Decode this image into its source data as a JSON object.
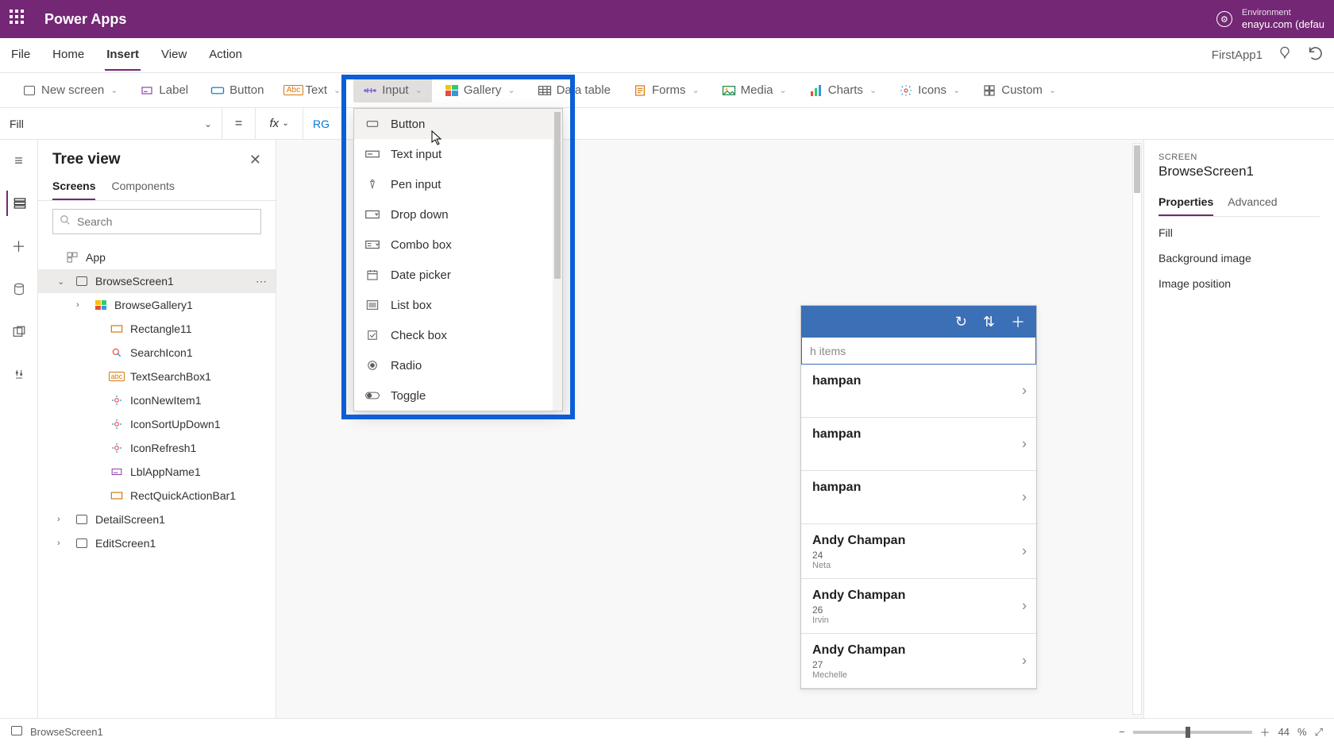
{
  "topbar": {
    "title": "Power Apps",
    "env_label": "Environment",
    "env_value": "enayu.com (defau"
  },
  "menubar": {
    "items": [
      "File",
      "Home",
      "Insert",
      "View",
      "Action"
    ],
    "active_index": 2,
    "app_name": "FirstApp1"
  },
  "ribbon": {
    "items": [
      {
        "label": "New screen",
        "chev": true
      },
      {
        "label": "Label"
      },
      {
        "label": "Button"
      },
      {
        "label": "Text",
        "chev": true
      },
      {
        "label": "Input",
        "chev": true,
        "expanded": true
      },
      {
        "label": "Gallery",
        "chev": true
      },
      {
        "label": "Data table"
      },
      {
        "label": "Forms",
        "chev": true
      },
      {
        "label": "Media",
        "chev": true
      },
      {
        "label": "Charts",
        "chev": true
      },
      {
        "label": "Icons",
        "chev": true
      },
      {
        "label": "Custom",
        "chev": true
      }
    ]
  },
  "formula": {
    "property": "Fill",
    "value": "RG"
  },
  "tree": {
    "title": "Tree view",
    "tabs": [
      "Screens",
      "Components"
    ],
    "active_tab": 0,
    "search_placeholder": "Search",
    "nodes": [
      {
        "label": "App",
        "level": 0,
        "icon": "app"
      },
      {
        "label": "BrowseScreen1",
        "level": 1,
        "icon": "screen",
        "expanded": true,
        "selected": true,
        "more": true
      },
      {
        "label": "BrowseGallery1",
        "level": 2,
        "icon": "gallery",
        "expandable": true
      },
      {
        "label": "Rectangle11",
        "level": 3,
        "icon": "rect"
      },
      {
        "label": "SearchIcon1",
        "level": 3,
        "icon": "search"
      },
      {
        "label": "TextSearchBox1",
        "level": 3,
        "icon": "textbox"
      },
      {
        "label": "IconNewItem1",
        "level": 3,
        "icon": "iconctrl"
      },
      {
        "label": "IconSortUpDown1",
        "level": 3,
        "icon": "iconctrl"
      },
      {
        "label": "IconRefresh1",
        "level": 3,
        "icon": "iconctrl"
      },
      {
        "label": "LblAppName1",
        "level": 3,
        "icon": "label"
      },
      {
        "label": "RectQuickActionBar1",
        "level": 3,
        "icon": "rect"
      },
      {
        "label": "DetailScreen1",
        "level": 1,
        "icon": "screen",
        "expandable": true
      },
      {
        "label": "EditScreen1",
        "level": 1,
        "icon": "screen",
        "expandable": true
      }
    ]
  },
  "input_menu": {
    "options": [
      "Button",
      "Text input",
      "Pen input",
      "Drop down",
      "Combo box",
      "Date picker",
      "List box",
      "Check box",
      "Radio",
      "Toggle"
    ],
    "hovered_index": 0
  },
  "phone": {
    "search_placeholder": "h items",
    "rows": [
      {
        "name": "hampan",
        "sub1": "",
        "sub2": ""
      },
      {
        "name": "hampan",
        "sub1": "",
        "sub2": ""
      },
      {
        "name": "hampan",
        "sub1": "",
        "sub2": ""
      },
      {
        "name": "Andy Champan",
        "sub1": "24",
        "sub2": "Neta"
      },
      {
        "name": "Andy Champan",
        "sub1": "26",
        "sub2": "Irvin"
      },
      {
        "name": "Andy Champan",
        "sub1": "27",
        "sub2": "Mechelle"
      }
    ]
  },
  "right": {
    "kicker": "SCREEN",
    "title": "BrowseScreen1",
    "tabs": [
      "Properties",
      "Advanced"
    ],
    "active_tab": 0,
    "props": [
      "Fill",
      "Background image",
      "Image position"
    ]
  },
  "status": {
    "breadcrumb": "BrowseScreen1",
    "zoom_value": "44",
    "zoom_unit": "%"
  }
}
